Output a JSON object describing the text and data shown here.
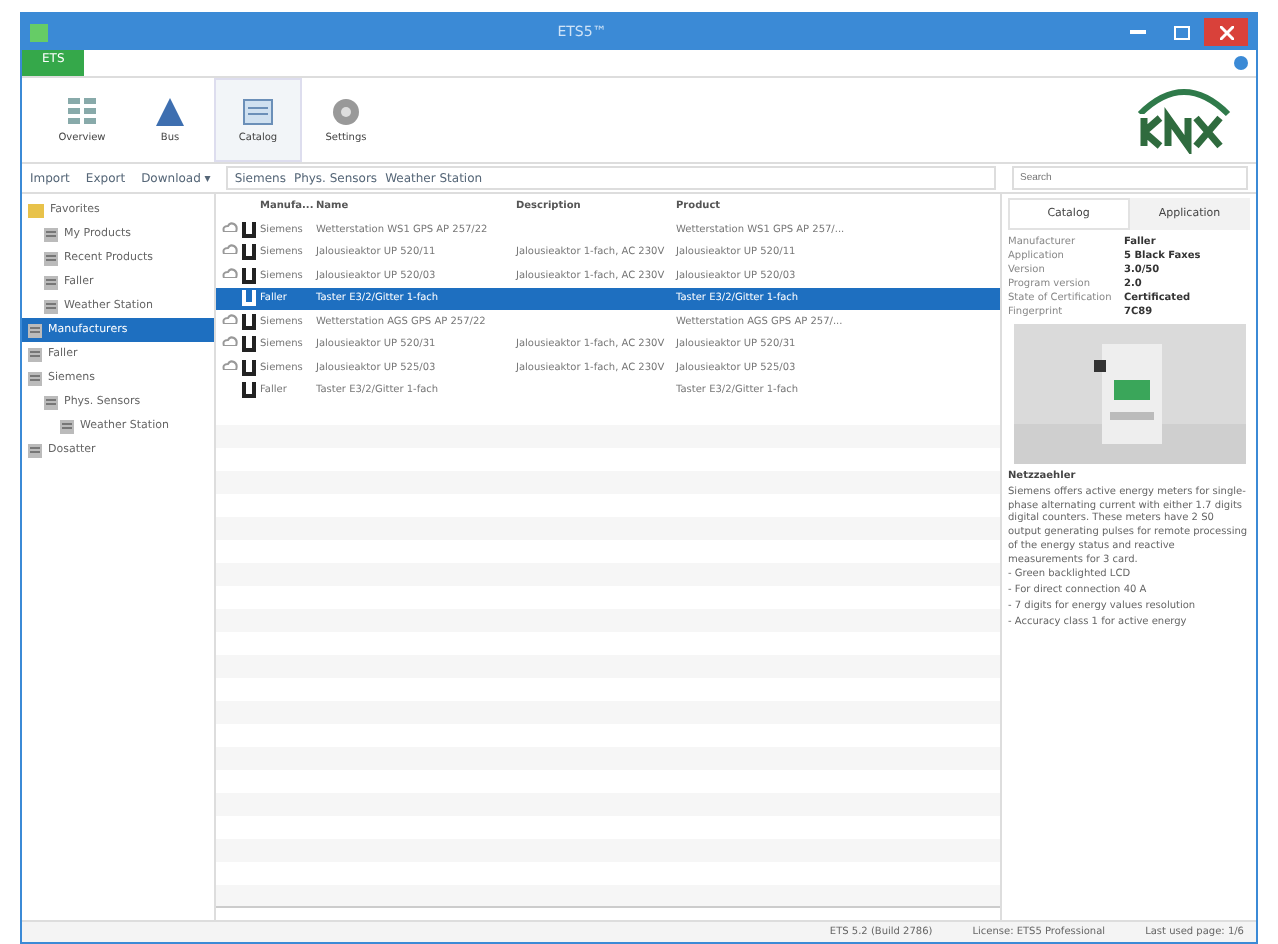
{
  "window": {
    "title": "ETS5™"
  },
  "app_tab": "ETS",
  "ribbon": [
    {
      "label": "Overview",
      "kind": "grid",
      "selected": false
    },
    {
      "label": "Bus",
      "kind": "bus",
      "selected": false
    },
    {
      "label": "Catalog",
      "kind": "catalog",
      "selected": true
    },
    {
      "label": "Settings",
      "kind": "gear",
      "selected": false
    }
  ],
  "toolbar": {
    "import": "Import",
    "export": "Export",
    "download": "Download ▾",
    "breadcrumb": [
      "Siemens",
      "Phys. Sensors",
      "Weather Station"
    ],
    "search": {
      "placeholder": "Search"
    }
  },
  "tree": [
    {
      "label": "Favorites",
      "kind": "folder",
      "selected": false,
      "children": [
        {
          "label": "My Products",
          "kind": "list",
          "selected": false
        },
        {
          "label": "Recent Products",
          "kind": "list",
          "selected": false
        },
        {
          "label": "Faller",
          "kind": "list",
          "selected": false
        },
        {
          "label": "Weather Station",
          "kind": "list",
          "selected": false
        }
      ]
    },
    {
      "label": "Manufacturers",
      "kind": "list",
      "selected": true
    },
    {
      "label": "Faller",
      "kind": "list",
      "selected": false
    },
    {
      "label": "Siemens",
      "kind": "list",
      "selected": false,
      "children": [
        {
          "label": "Phys. Sensors",
          "kind": "list",
          "selected": false,
          "children": [
            {
              "label": "Weather Station",
              "kind": "list",
              "selected": false
            }
          ]
        }
      ]
    },
    {
      "label": "Dosatter",
      "kind": "list",
      "selected": false
    }
  ],
  "table": {
    "columns": [
      "Manufa...",
      "Name",
      "Description",
      "Product"
    ],
    "rows": [
      {
        "cloud": true,
        "selected": false,
        "cells": [
          "Siemens",
          "Wetterstation WS1 GPS AP 257/22",
          "",
          "Wetterstation WS1 GPS AP 257/..."
        ]
      },
      {
        "cloud": true,
        "selected": false,
        "cells": [
          "Siemens",
          "Jalousieaktor UP 520/11",
          "Jalousieaktor 1-fach, AC 230V",
          "Jalousieaktor UP 520/11"
        ]
      },
      {
        "cloud": true,
        "selected": false,
        "cells": [
          "Siemens",
          "Jalousieaktor UP 520/03",
          "Jalousieaktor 1-fach, AC 230V",
          "Jalousieaktor UP 520/03"
        ]
      },
      {
        "cloud": false,
        "selected": true,
        "cells": [
          "Faller",
          "Taster E3/2/Gitter 1-fach",
          "",
          "Taster E3/2/Gitter 1-fach"
        ]
      },
      {
        "cloud": true,
        "selected": false,
        "cells": [
          "Siemens",
          "Wetterstation AGS GPS AP 257/22",
          "",
          "Wetterstation AGS GPS AP 257/..."
        ]
      },
      {
        "cloud": true,
        "selected": false,
        "cells": [
          "Siemens",
          "Jalousieaktor UP 520/31",
          "Jalousieaktor 1-fach, AC 230V",
          "Jalousieaktor UP 520/31"
        ]
      },
      {
        "cloud": true,
        "selected": false,
        "cells": [
          "Siemens",
          "Jalousieaktor UP 525/03",
          "Jalousieaktor 1-fach, AC 230V",
          "Jalousieaktor UP 525/03"
        ]
      },
      {
        "cloud": false,
        "selected": false,
        "cells": [
          "Faller",
          "Taster E3/2/Gitter 1-fach",
          "",
          "Taster E3/2/Gitter 1-fach"
        ]
      }
    ]
  },
  "details": {
    "tabs": [
      {
        "label": "Catalog",
        "selected": true
      },
      {
        "label": "Application",
        "selected": false
      }
    ],
    "properties": [
      {
        "name": "Manufacturer",
        "value": "Faller"
      },
      {
        "name": "Application",
        "value": "5 Black Faxes"
      },
      {
        "name": "Version",
        "value": "3.0/50"
      },
      {
        "name": "Program version",
        "value": "2.0"
      },
      {
        "name": "State of Certification",
        "value": "Certificated"
      },
      {
        "name": "Fingerprint",
        "value": "7C89"
      }
    ],
    "heading": "Netzzaehler",
    "paragraphs": [
      "Siemens offers active energy meters for single-phase alternating current with either 1.7 digits digital counters. These meters have 2 S0 output generating pulses for remote processing of the energy status and reactive measurements for 3 card.",
      "- Green backlighted LCD",
      "- For direct connection 40 A",
      "- 7 digits for energy values resolution",
      "- Accuracy class 1 for active energy"
    ]
  },
  "status_bar": [
    "ETS 5.2 (Build 2786)",
    "License: ETS5 Professional",
    "Last used page: 1/6"
  ]
}
